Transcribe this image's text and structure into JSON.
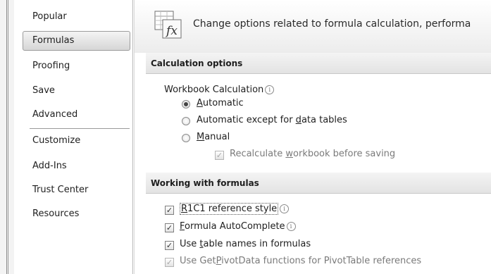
{
  "sidebar": {
    "items": [
      {
        "label": "Popular"
      },
      {
        "label": "Formulas"
      },
      {
        "label": "Proofing"
      },
      {
        "label": "Save"
      },
      {
        "label": "Advanced"
      },
      {
        "label": "Customize"
      },
      {
        "label": "Add-Ins"
      },
      {
        "label": "Trust Center"
      },
      {
        "label": "Resources"
      }
    ],
    "selected": "Formulas"
  },
  "header": {
    "text": "Change options related to formula calculation, performa",
    "icon": "formula-fx-icon"
  },
  "calculation": {
    "section_title": "Calculation options",
    "workbook_label": "Workbook Calculation",
    "automatic": {
      "pre": "",
      "key": "A",
      "post": "utomatic"
    },
    "automatic_except": {
      "pre": "Automatic except for ",
      "key": "d",
      "post": "ata tables"
    },
    "manual": {
      "pre": "",
      "key": "M",
      "post": "anual"
    },
    "recalc": {
      "pre": "Recalculate ",
      "key": "w",
      "post": "orkbook before saving"
    },
    "selected": "Automatic",
    "recalc_checked": true
  },
  "formulas": {
    "section_title": "Working with formulas",
    "r1c1": {
      "pre": "",
      "key": "R",
      "post": "1C1 reference style",
      "checked": true
    },
    "autocomplete": {
      "pre": "",
      "key": "F",
      "post": "ormula AutoComplete",
      "checked": true
    },
    "table_names": {
      "pre": "Use ",
      "key": "t",
      "post": "able names in formulas",
      "checked": true
    },
    "getpivot": {
      "pre": "Use Get",
      "key": "P",
      "post": "ivotData functions for PivotTable references",
      "checked": true
    }
  },
  "glyphs": {
    "check": "✓",
    "info": "i"
  },
  "colors": {
    "selected_bg": "#dcdcdc",
    "section_bg": "#ececec"
  }
}
